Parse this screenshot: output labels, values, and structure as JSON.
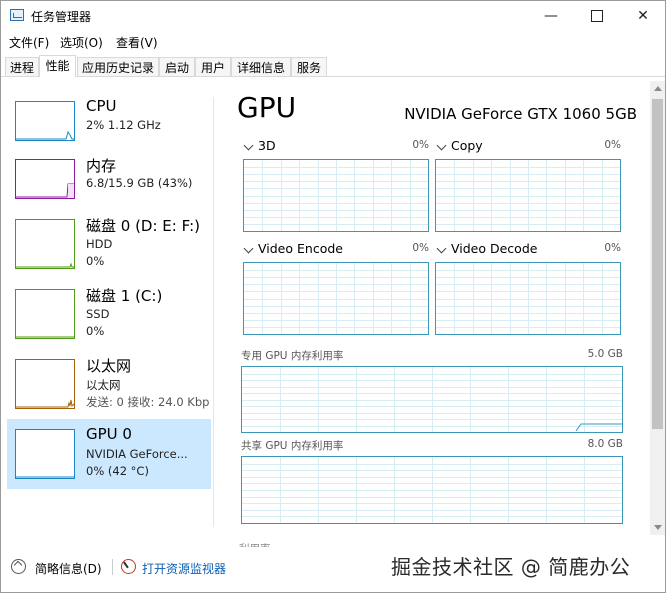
{
  "window": {
    "title": "任务管理器",
    "minimize": "—",
    "close": "✕"
  },
  "menu": [
    "文件(F)",
    "选项(O)",
    "查看(V)"
  ],
  "tabs": [
    "进程",
    "性能",
    "应用历史记录",
    "启动",
    "用户",
    "详细信息",
    "服务"
  ],
  "active_tab": "性能",
  "resources": [
    {
      "title": "CPU",
      "lines": [
        "2% 1.12 GHz"
      ],
      "color": "#1a86c8"
    },
    {
      "title": "内存",
      "lines": [
        "6.8/15.9 GB (43%)"
      ],
      "color": "#8b1b9c"
    },
    {
      "title": "磁盘 0 (D: E: F:)",
      "lines": [
        "HDD",
        "0%"
      ],
      "color": "#4f9a16"
    },
    {
      "title": "磁盘 1 (C:)",
      "lines": [
        "SSD",
        "0%"
      ],
      "color": "#4f9a16"
    },
    {
      "title": "以太网",
      "lines": [
        "以太网",
        "发送: 0 接收: 24.0 Kbp"
      ],
      "color": "#a7600a"
    },
    {
      "title": "GPU 0",
      "lines": [
        "NVIDIA GeForce...",
        "0% (42 °C)"
      ],
      "color": "#1a86c8",
      "selected": true
    }
  ],
  "gpu": {
    "title": "GPU",
    "name": "NVIDIA GeForce GTX 1060 5GB",
    "engines": [
      {
        "label": "3D",
        "percent": "0%"
      },
      {
        "label": "Copy",
        "percent": "0%"
      },
      {
        "label": "Video Encode",
        "percent": "0%"
      },
      {
        "label": "Video Decode",
        "percent": "0%"
      }
    ],
    "dedicated": {
      "label": "专用 GPU 内存利用率",
      "max": "5.0 GB"
    },
    "shared": {
      "label": "共享 GPU 内存利用率",
      "max": "8.0 GB"
    },
    "cutoff_label": "利用率"
  },
  "bottom": {
    "less_details": "简略信息(D)",
    "resource_monitor": "打开资源监视器",
    "watermark": "掘金技术社区 @ 简鹿办公"
  },
  "colors": {
    "gpu_graph_border": "#3b97b8",
    "grid": "#d6edf4",
    "link": "#0a5fb4",
    "selected_bg": "#cce8ff"
  }
}
